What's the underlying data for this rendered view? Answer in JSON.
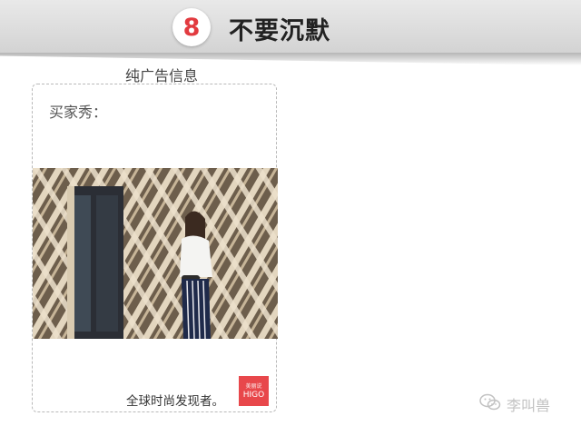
{
  "header": {
    "number": "8",
    "title": "不要沉默"
  },
  "ad_label": "纯广告信息",
  "card": {
    "buyer_label": "买家秀：",
    "slogan": "全球时尚发现者。",
    "logo": {
      "line1": "美丽说",
      "line2": "HIGO"
    }
  },
  "watermark": {
    "icon": "wechat-icon",
    "text": "李叫兽"
  },
  "colors": {
    "accent": "#e23a3f",
    "logo_bg": "#e8474b",
    "header_bg": "#dcdcdc"
  }
}
